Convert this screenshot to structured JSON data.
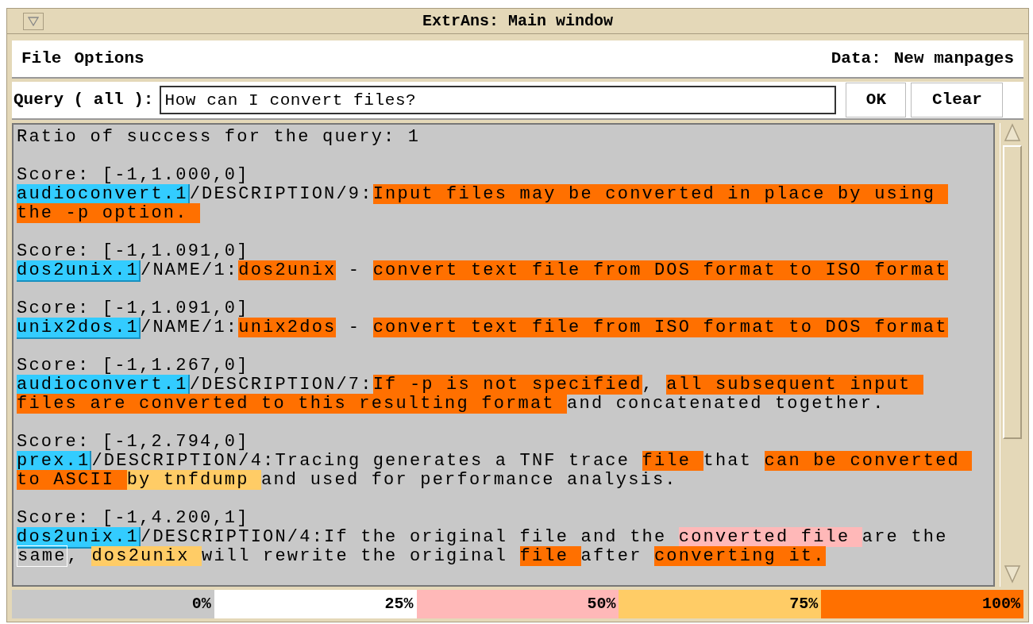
{
  "window": {
    "title": "ExtrAns: Main window"
  },
  "menu": [
    {
      "label": "File"
    },
    {
      "label": "Options"
    }
  ],
  "data_source": {
    "label": "Data:",
    "value": "New manpages"
  },
  "query": {
    "label": "Query ( all ):",
    "value": "How can I convert files?"
  },
  "buttons": [
    {
      "label": "OK"
    },
    {
      "label": "Clear"
    }
  ],
  "ratio": "Ratio of success for the query: 1",
  "results": [
    {
      "score": "Score: [-1,1.000,0]",
      "file": "audioconvert.1",
      "path": "/DESCRIPTION/9:",
      "segments": [
        {
          "kind": "highlight",
          "text": "Input files may be converted in place by using the -p option. ",
          "color": "#ff7000"
        }
      ]
    },
    {
      "score": "Score: [-1,1.091,0]",
      "file": "dos2unix.1",
      "path": "/NAME/1:",
      "segments": [
        {
          "kind": "highlight",
          "text": "dos2unix",
          "color": "#ff7000"
        },
        {
          "kind": "text",
          "text": " - "
        },
        {
          "kind": "highlight",
          "text": "convert text file from DOS format to ISO format",
          "color": "#ff7000"
        }
      ]
    },
    {
      "score": "Score: [-1,1.091,0]",
      "file": "unix2dos.1",
      "path": "/NAME/1:",
      "segments": [
        {
          "kind": "highlight",
          "text": "unix2dos",
          "color": "#ff7000"
        },
        {
          "kind": "text",
          "text": " - "
        },
        {
          "kind": "highlight",
          "text": "convert text file from ISO format to DOS format",
          "color": "#ff7000"
        }
      ]
    },
    {
      "score": "Score: [-1,1.267,0]",
      "file": "audioconvert.1",
      "path": "/DESCRIPTION/7:",
      "segments": [
        {
          "kind": "highlight",
          "text": "If -p is not specified",
          "color": "#ff7000"
        },
        {
          "kind": "text",
          "text": ", "
        },
        {
          "kind": "highlight",
          "text": "all subsequent input files are converted to this resulting format ",
          "color": "#ff7000"
        },
        {
          "kind": "text",
          "text": "and concatenated together."
        }
      ]
    },
    {
      "score": "Score: [-1,2.794,0]",
      "file": "prex.1",
      "path": "/DESCRIPTION/4:",
      "segments": [
        {
          "kind": "text",
          "text": "Tracing generates a TNF trace "
        },
        {
          "kind": "highlight",
          "text": "file ",
          "color": "#ff7000"
        },
        {
          "kind": "text",
          "text": "that "
        },
        {
          "kind": "highlight",
          "text": "can be converted to ASCII ",
          "color": "#ff7000"
        },
        {
          "kind": "highlight",
          "text": "by tnfdump ",
          "color": "#ffcc66"
        },
        {
          "kind": "text",
          "text": "and used for performance analysis."
        }
      ]
    },
    {
      "score": "Score: [-1,4.200,1]",
      "file": "dos2unix.1",
      "path": "/DESCRIPTION/4:",
      "segments": [
        {
          "kind": "text",
          "text": "If the original file and the "
        },
        {
          "kind": "highlight",
          "text": "converted file ",
          "color": "#ffb8b8"
        },
        {
          "kind": "text",
          "text": "are the "
        },
        {
          "kind": "boxed",
          "text": "same"
        },
        {
          "kind": "text",
          "text": ", "
        },
        {
          "kind": "highlight",
          "text": "dos2unix ",
          "color": "#ffcc66"
        },
        {
          "kind": "text",
          "text": "will rewrite the original "
        },
        {
          "kind": "highlight",
          "text": "file ",
          "color": "#ff7000"
        },
        {
          "kind": "text",
          "text": "after "
        },
        {
          "kind": "highlight",
          "text": "converting it.",
          "color": "#ff7000"
        }
      ]
    }
  ],
  "legend": [
    {
      "label": "0%",
      "color": "#c8c8c8"
    },
    {
      "label": "25%",
      "color": "#ffffff"
    },
    {
      "label": "50%",
      "color": "#ffb8b8"
    },
    {
      "label": "75%",
      "color": "#ffcc66"
    },
    {
      "label": "100%",
      "color": "#ff7000"
    }
  ]
}
